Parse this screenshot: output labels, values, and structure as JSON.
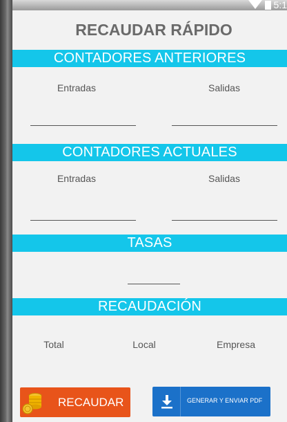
{
  "status_bar": {
    "time": "5:1"
  },
  "app": {
    "title": "RECAUDAR RÁPIDO"
  },
  "sections": {
    "anteriores": {
      "title": "CONTADORES ANTERIORES",
      "entradas_label": "Entradas",
      "salidas_label": "Salidas"
    },
    "actuales": {
      "title": "CONTADORES ACTUALES",
      "entradas_label": "Entradas",
      "salidas_label": "Salidas"
    },
    "tasas": {
      "title": "TASAS"
    },
    "recaudacion": {
      "title": "RECAUDACIÓN",
      "total_label": "Total",
      "local_label": "Local",
      "empresa_label": "Empresa"
    }
  },
  "buttons": {
    "recaudar": {
      "label": "RECAUDAR",
      "icon": "coins-icon"
    },
    "pdf": {
      "label": "GENERAR Y ENVIAR PDF",
      "icon": "download-icon"
    }
  },
  "colors": {
    "section_band": "#14c6ea",
    "recaudar_button": "#e8541a",
    "pdf_button": "#1b71c9",
    "background": "#f2f2f2",
    "title": "#6a6a6a"
  }
}
